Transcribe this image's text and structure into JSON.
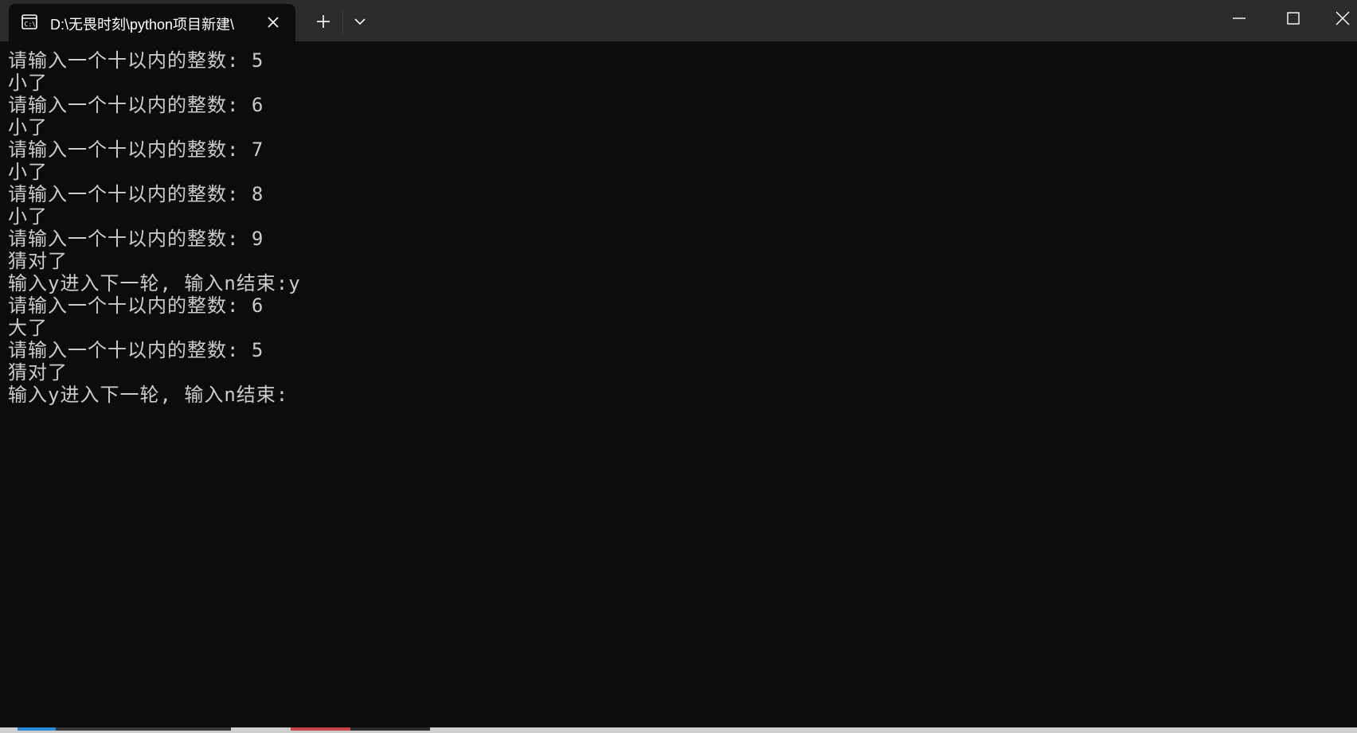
{
  "window": {
    "tab_title": "D:\\无畏时刻\\python项目新建\\"
  },
  "terminal": {
    "lines": [
      "请输入一个十以内的整数: 5",
      "小了",
      "请输入一个十以内的整数: 6",
      "小了",
      "请输入一个十以内的整数: 7",
      "小了",
      "请输入一个十以内的整数: 8",
      "小了",
      "请输入一个十以内的整数: 9",
      "猜对了",
      "输入y进入下一轮, 输入n结束:y",
      "请输入一个十以内的整数: 6",
      "大了",
      "请输入一个十以内的整数: 5",
      "猜对了",
      "输入y进入下一轮, 输入n结束:"
    ]
  },
  "icons": {
    "tab": "terminal-icon",
    "close_tab": "close-icon",
    "new_tab": "plus-icon",
    "dropdown": "chevron-down-icon",
    "minimize": "minimize-icon",
    "maximize": "maximize-icon",
    "close_window": "close-icon"
  },
  "colors": {
    "background": "#0c0c0c",
    "titlebar": "#2b2b2b",
    "text": "#cccccc"
  }
}
